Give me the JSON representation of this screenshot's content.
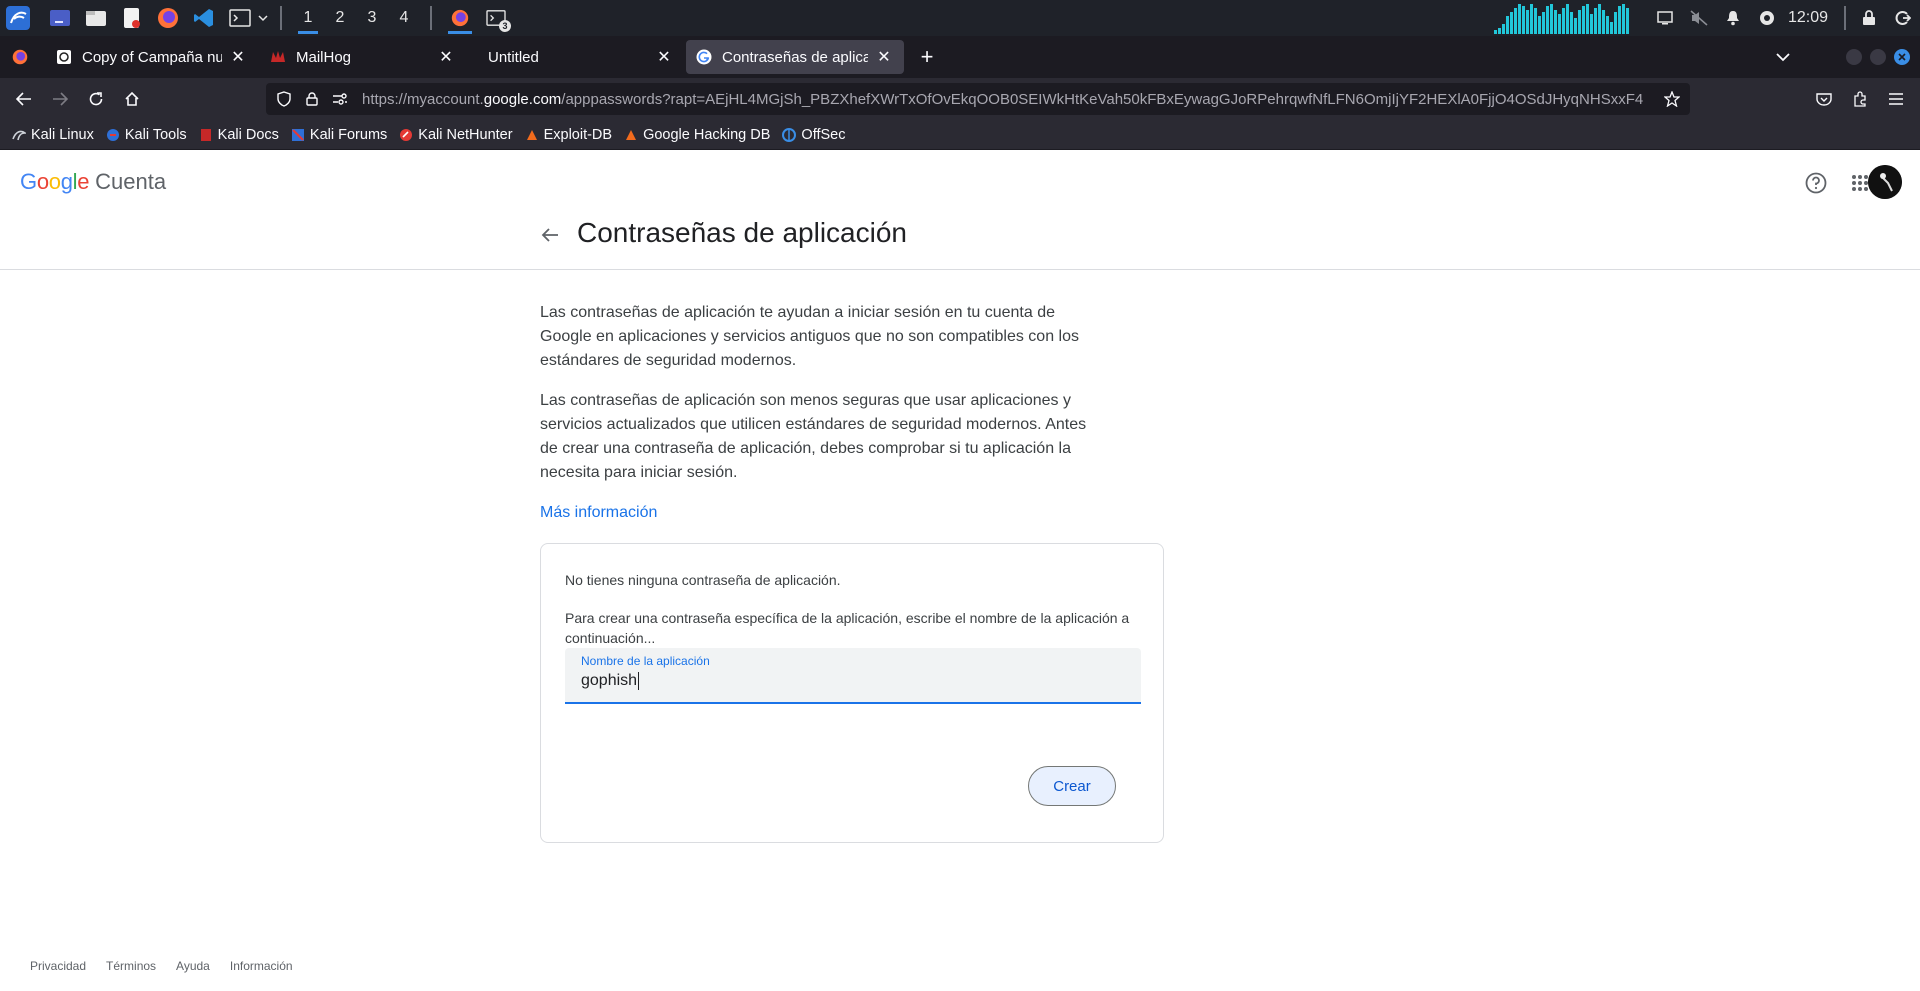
{
  "taskbar": {
    "workspaces": [
      "1",
      "2",
      "3",
      "4"
    ],
    "terminal_badge": "3",
    "clock": "12:09"
  },
  "tabs": [
    {
      "title": "Copy of Campaña nuevo i",
      "active": false
    },
    {
      "title": "MailHog",
      "active": false
    },
    {
      "title": "Untitled",
      "active": false
    },
    {
      "title": "Contraseñas de aplicación",
      "active": true
    }
  ],
  "navbar": {
    "url_prefix": "https://myaccount.",
    "url_domain": "google.com",
    "url_rest": "/apppasswords?rapt=AEjHL4MGjSh_PBZXhefXWrTxOfOvEkqOOB0SEIWkHtKeVah50kFBxEywagGJoRPehrqwfNfLFN6OmjIjYF2HEXlA0FjjO4OSdJHyqNHSxxF4"
  },
  "bookmarks": [
    "Kali Linux",
    "Kali Tools",
    "Kali Docs",
    "Kali Forums",
    "Kali NetHunter",
    "Exploit-DB",
    "Google Hacking DB",
    "OffSec"
  ],
  "header": {
    "logo_letters": [
      "G",
      "o",
      "o",
      "g",
      "l",
      "e"
    ],
    "product": "Cuenta"
  },
  "page": {
    "title": "Contraseñas de aplicación",
    "para1": "Las contraseñas de aplicación te ayudan a iniciar sesión en tu cuenta de Google en aplicaciones y servicios antiguos que no son compatibles con los estándares de seguridad modernos.",
    "para2": "Las contraseñas de aplicación son menos seguras que usar aplicaciones y servicios actualizados que utilicen estándares de seguridad modernos. Antes de crear una contraseña de aplicación, debes comprobar si tu aplicación la necesita para iniciar sesión.",
    "more_info": "Más información"
  },
  "card": {
    "empty_text": "No tienes ninguna contraseña de aplicación.",
    "instructions": "Para crear una contraseña específica de la aplicación, escribe el nombre de la aplicación a continuación...",
    "field_label": "Nombre de la aplicación",
    "field_value": "gophish",
    "create_label": "Crear"
  },
  "footer": [
    "Privacidad",
    "Términos",
    "Ayuda",
    "Información"
  ],
  "colors": {
    "link": "#1a73e8",
    "google_blue": "#4285f4",
    "google_red": "#ea4335",
    "google_yellow": "#fbbc05",
    "google_green": "#34a853"
  }
}
